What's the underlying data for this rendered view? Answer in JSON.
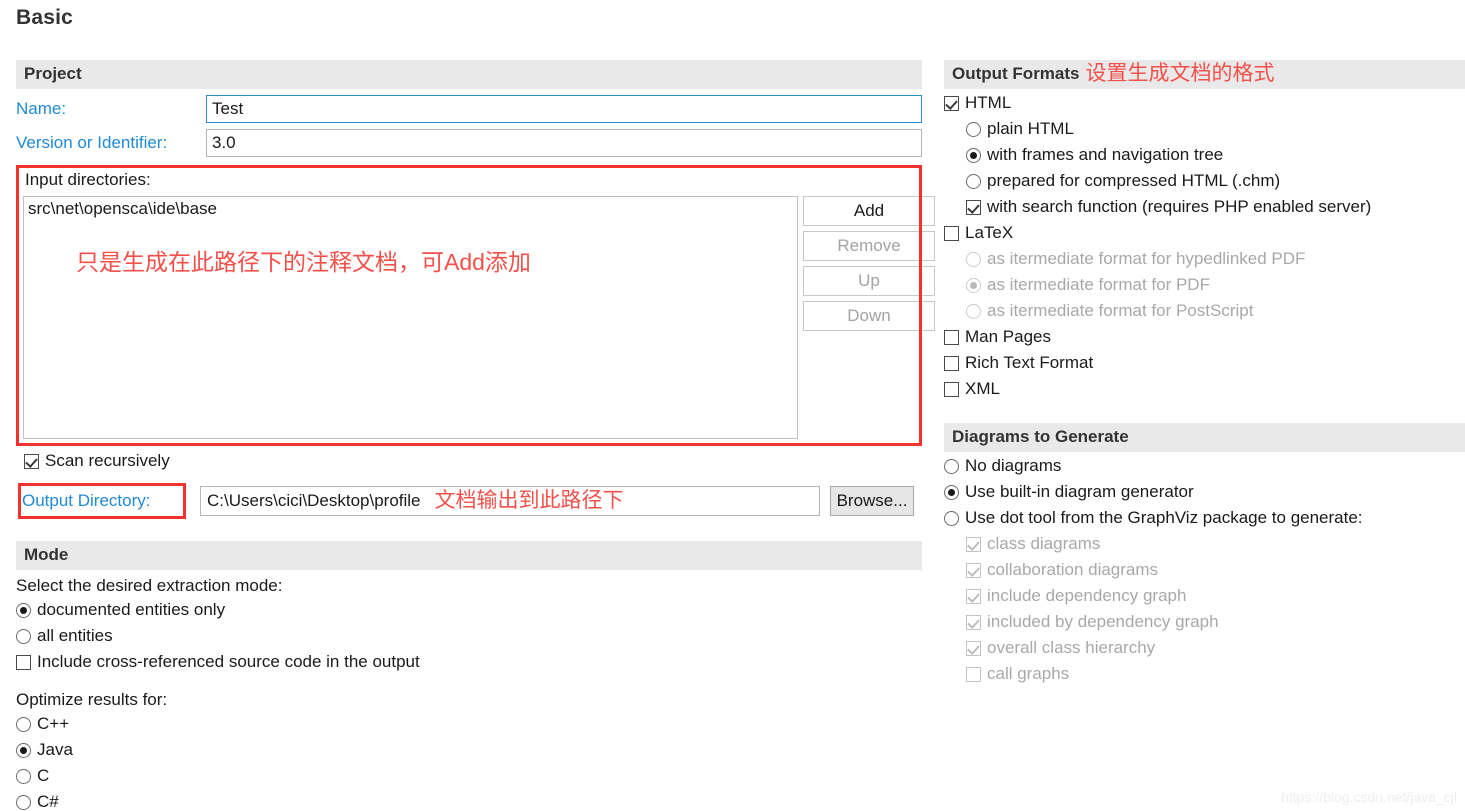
{
  "page": {
    "title": "Basic",
    "watermark": "https://blog.csdn.net/java_cjl"
  },
  "project": {
    "header": "Project",
    "name_label": "Name:",
    "name_value": "Test",
    "version_label": "Version or Identifier:",
    "version_value": "3.0",
    "input_dirs_label": "Input directories:",
    "input_dirs": [
      "src\\net\\opensca\\ide\\base"
    ],
    "input_dirs_note_zh": "只是生成在此路径下的注释文档，可Add添加",
    "buttons": [
      {
        "label": "Add",
        "enabled": true
      },
      {
        "label": "Remove",
        "enabled": false
      },
      {
        "label": "Up",
        "enabled": false
      },
      {
        "label": "Down",
        "enabled": false
      }
    ],
    "scan_recursively_label": "Scan recursively",
    "scan_recursively_checked": true,
    "output_directory_label": "Output Directory:",
    "output_directory_value": "C:\\Users\\cici\\Desktop\\profile",
    "output_directory_note_zh": "文档输出到此路径下",
    "browse_label": "Browse..."
  },
  "mode": {
    "header": "Mode",
    "prompt": "Select the desired extraction mode:",
    "extraction_options": [
      {
        "label": "documented entities only",
        "selected": true
      },
      {
        "label": "all entities",
        "selected": false
      }
    ],
    "cross_ref_label": "Include cross-referenced source code in the output",
    "cross_ref_checked": false,
    "optimize_prompt": "Optimize results for:",
    "optimize_options": [
      {
        "label": "C++",
        "selected": false
      },
      {
        "label": "Java",
        "selected": true
      },
      {
        "label": "C",
        "selected": false
      },
      {
        "label": "C#",
        "selected": false
      }
    ]
  },
  "output_formats": {
    "header": "Output Formats",
    "header_note_zh": "设置生成文档的格式",
    "html": {
      "label": "HTML",
      "checked": true
    },
    "html_sub_radios": [
      {
        "label": "plain HTML",
        "selected": false
      },
      {
        "label": "with frames and navigation tree",
        "selected": true
      },
      {
        "label": "prepared for compressed HTML (.chm)",
        "selected": false
      }
    ],
    "html_search": {
      "label": "with search function (requires PHP enabled server)",
      "checked": true
    },
    "latex": {
      "label": "LaTeX",
      "checked": false
    },
    "latex_sub_radios": [
      {
        "label": "as itermediate format for hypedlinked PDF",
        "selected": false,
        "disabled": true
      },
      {
        "label": "as itermediate format for PDF",
        "selected": true,
        "disabled": true
      },
      {
        "label": "as itermediate format for PostScript",
        "selected": false,
        "disabled": true
      }
    ],
    "others": [
      {
        "label": "Man Pages",
        "checked": false
      },
      {
        "label": "Rich Text Format",
        "checked": false
      },
      {
        "label": "XML",
        "checked": false
      }
    ]
  },
  "diagrams": {
    "header": "Diagrams to Generate",
    "radios": [
      {
        "label": "No diagrams",
        "selected": false
      },
      {
        "label": "Use built-in diagram generator",
        "selected": true
      },
      {
        "label": "Use dot tool from the GraphViz package to generate:",
        "selected": false
      }
    ],
    "checkboxes": [
      {
        "label": "class diagrams",
        "checked": true,
        "disabled": true
      },
      {
        "label": "collaboration diagrams",
        "checked": true,
        "disabled": true
      },
      {
        "label": "include dependency graph",
        "checked": true,
        "disabled": true
      },
      {
        "label": "included by dependency graph",
        "checked": true,
        "disabled": true
      },
      {
        "label": "overall class hierarchy",
        "checked": true,
        "disabled": true
      },
      {
        "label": "call graphs",
        "checked": false,
        "disabled": true
      }
    ]
  },
  "colors": {
    "accent_blue": "#1f8ad6",
    "annotation_red": "#f4322c",
    "section_header_bg": "#e9e9e9"
  }
}
